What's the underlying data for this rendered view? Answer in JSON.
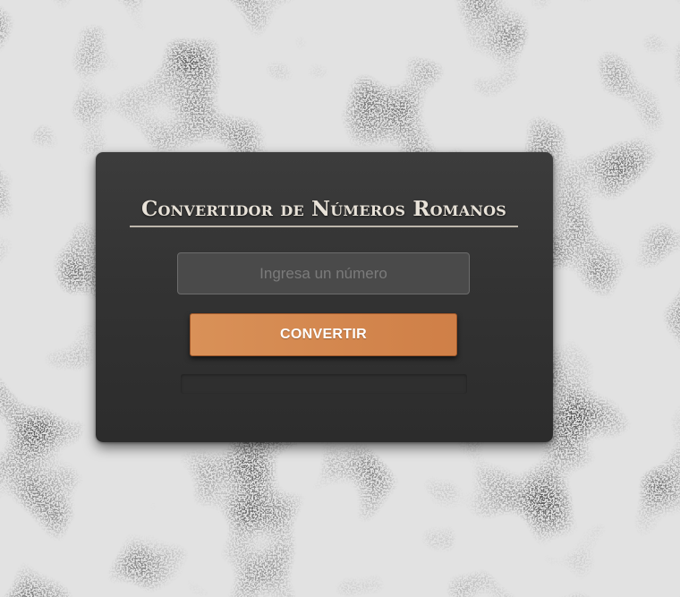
{
  "app": {
    "title": "Convertidor de Números Romanos"
  },
  "input": {
    "placeholder": "Ingresa un número",
    "value": ""
  },
  "button": {
    "label": "CONVERTIR"
  },
  "result": {
    "text": ""
  },
  "colors": {
    "background": "#e2e2e2",
    "card": "#353535",
    "accent": "#d5894f",
    "title_text": "#e8e2d8"
  }
}
